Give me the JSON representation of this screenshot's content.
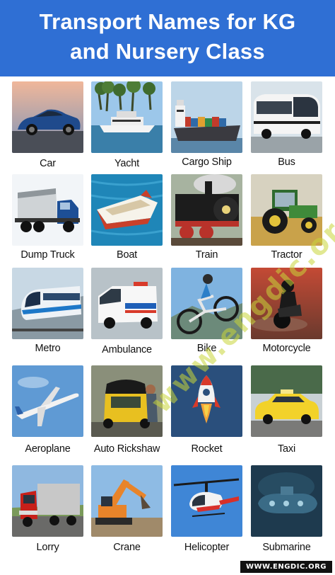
{
  "header": {
    "title_line1": "Transport Names for KG",
    "title_line2": "and Nursery Class",
    "background": "#2f6fd4"
  },
  "items": [
    {
      "label": "Car",
      "icon": "car-photo"
    },
    {
      "label": "Yacht",
      "icon": "yacht-photo"
    },
    {
      "label": "Cargo Ship",
      "icon": "cargo-ship-photo"
    },
    {
      "label": "Bus",
      "icon": "bus-photo"
    },
    {
      "label": "Dump Truck",
      "icon": "dump-truck-photo"
    },
    {
      "label": "Boat",
      "icon": "boat-photo"
    },
    {
      "label": "Train",
      "icon": "train-photo"
    },
    {
      "label": "Tractor",
      "icon": "tractor-photo"
    },
    {
      "label": "Metro",
      "icon": "metro-photo"
    },
    {
      "label": "Ambulance",
      "icon": "ambulance-photo"
    },
    {
      "label": "Bike",
      "icon": "bike-photo"
    },
    {
      "label": "Motorcycle",
      "icon": "motorcycle-photo"
    },
    {
      "label": "Aeroplane",
      "icon": "aeroplane-photo"
    },
    {
      "label": "Auto Rickshaw",
      "icon": "auto-rickshaw-photo"
    },
    {
      "label": "Rocket",
      "icon": "rocket-photo"
    },
    {
      "label": "Taxi",
      "icon": "taxi-photo"
    },
    {
      "label": "Lorry",
      "icon": "lorry-photo"
    },
    {
      "label": "Crane",
      "icon": "crane-photo"
    },
    {
      "label": "Helicopter",
      "icon": "helicopter-photo"
    },
    {
      "label": "Submarine",
      "icon": "submarine-photo"
    }
  ],
  "watermark": "www.engdic.org",
  "footer": "WWW.ENGDIC.ORG"
}
